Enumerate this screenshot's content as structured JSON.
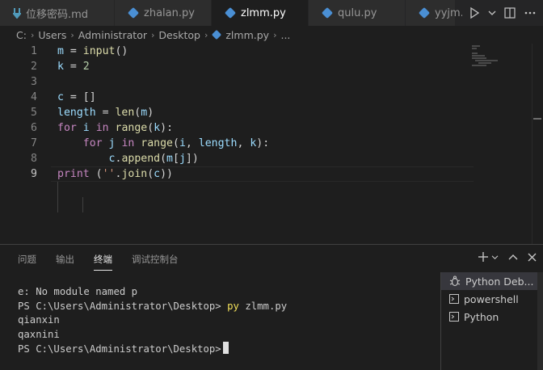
{
  "tabs": [
    {
      "label": "位移密码.md",
      "icon": "markdown-icon",
      "active": false
    },
    {
      "label": "zhalan.py",
      "icon": "python-icon",
      "active": false
    },
    {
      "label": "zlmm.py",
      "icon": "python-icon",
      "active": true,
      "dirty": true
    },
    {
      "label": "qulu.py",
      "icon": "python-icon",
      "active": false
    },
    {
      "label": "yyjm.p",
      "icon": "python-icon",
      "active": false
    }
  ],
  "tab_actions": [
    "run-icon",
    "chevron-down-icon",
    "split-editor-icon",
    "more-icon"
  ],
  "breadcrumb": {
    "parts": [
      "C:",
      "Users",
      "Administrator",
      "Desktop"
    ],
    "file": "zlmm.py",
    "ellipsis": "..."
  },
  "editor": {
    "line_numbers": [
      "1",
      "2",
      "3",
      "4",
      "5",
      "6",
      "7",
      "8",
      "9"
    ],
    "current_line": 9,
    "lines_text": [
      "m = input()",
      "k = 2",
      "",
      "c = []",
      "length = len(m)",
      "for i in range(k):",
      "    for j in range(i, length, k):",
      "        c.append(m[j])",
      "print (''.join(c))"
    ]
  },
  "panel": {
    "tabs": [
      "问题",
      "输出",
      "终端",
      "调试控制台"
    ],
    "active_tab": "终端",
    "terminal_lines": [
      {
        "text": "e: No module named p"
      },
      {
        "prompt": "PS C:\\Users\\Administrator\\Desktop>",
        "command": " py",
        "args": " zlmm.py"
      },
      {
        "text": "qianxin"
      },
      {
        "text": "qaxnini"
      },
      {
        "prompt": "PS C:\\Users\\Administrator\\Desktop>"
      }
    ],
    "terminal_list": [
      {
        "label": "Python Deb...",
        "icon": "debug-icon",
        "selected": true
      },
      {
        "label": "powershell",
        "icon": "terminal-icon",
        "selected": false
      },
      {
        "label": "Python",
        "icon": "terminal-icon",
        "selected": false
      }
    ]
  },
  "colors": {
    "background": "#1e1e1e",
    "tab_inactive": "#2d2d2d",
    "python_icon": "#4a8fd4",
    "markdown_icon": "#519aba",
    "keyword": "#c586c0",
    "function": "#dcdcaa",
    "number": "#b5cea8"
  }
}
